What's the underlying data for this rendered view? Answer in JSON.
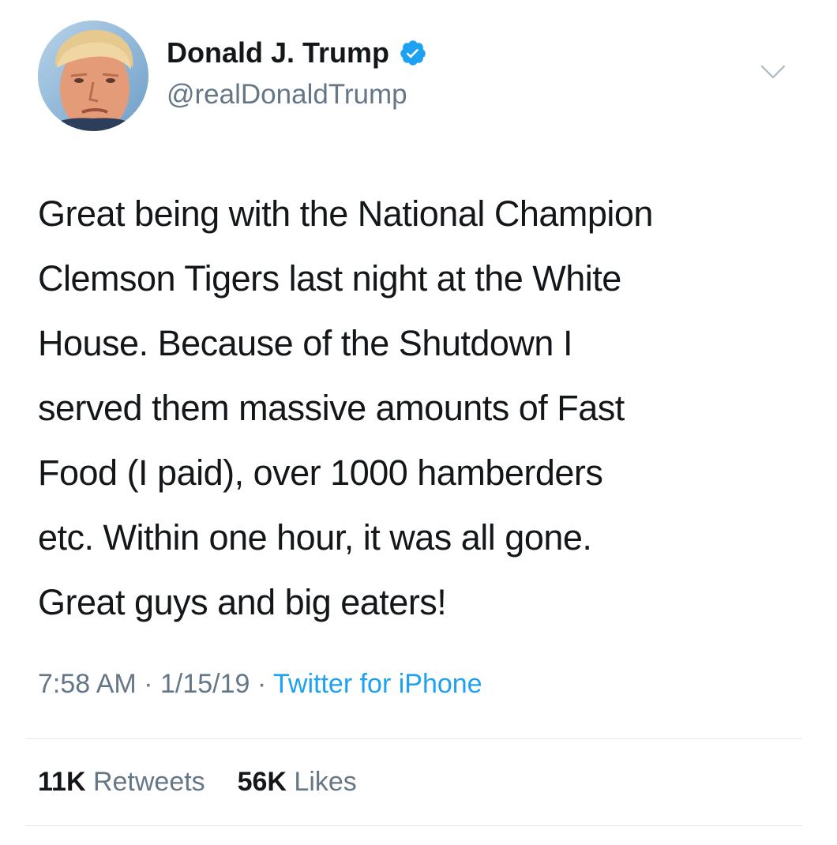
{
  "author": {
    "display_name": "Donald J. Trump",
    "handle": "@realDonaldTrump",
    "verified_icon": "verified-badge-icon",
    "avatar": "profile-photo"
  },
  "tweet": {
    "lines": [
      "Great being with the National Champion",
      "Clemson Tigers last night at the White",
      "House. Because of the Shutdown I",
      "served them massive amounts of Fast",
      "Food (I paid), over 1000 hamberders",
      "etc. Within one hour, it was all gone.",
      "Great guys and big eaters!"
    ],
    "time": "7:58 AM",
    "separator": " · ",
    "date": "1/15/19",
    "source": "Twitter for iPhone"
  },
  "stats": {
    "retweets_count": "11K",
    "retweets_label": "Retweets",
    "likes_count": "56K",
    "likes_label": "Likes"
  },
  "colors": {
    "text": "#14171a",
    "secondary": "#657786",
    "accent": "#1da1f2",
    "divider": "#e1e8ed"
  }
}
